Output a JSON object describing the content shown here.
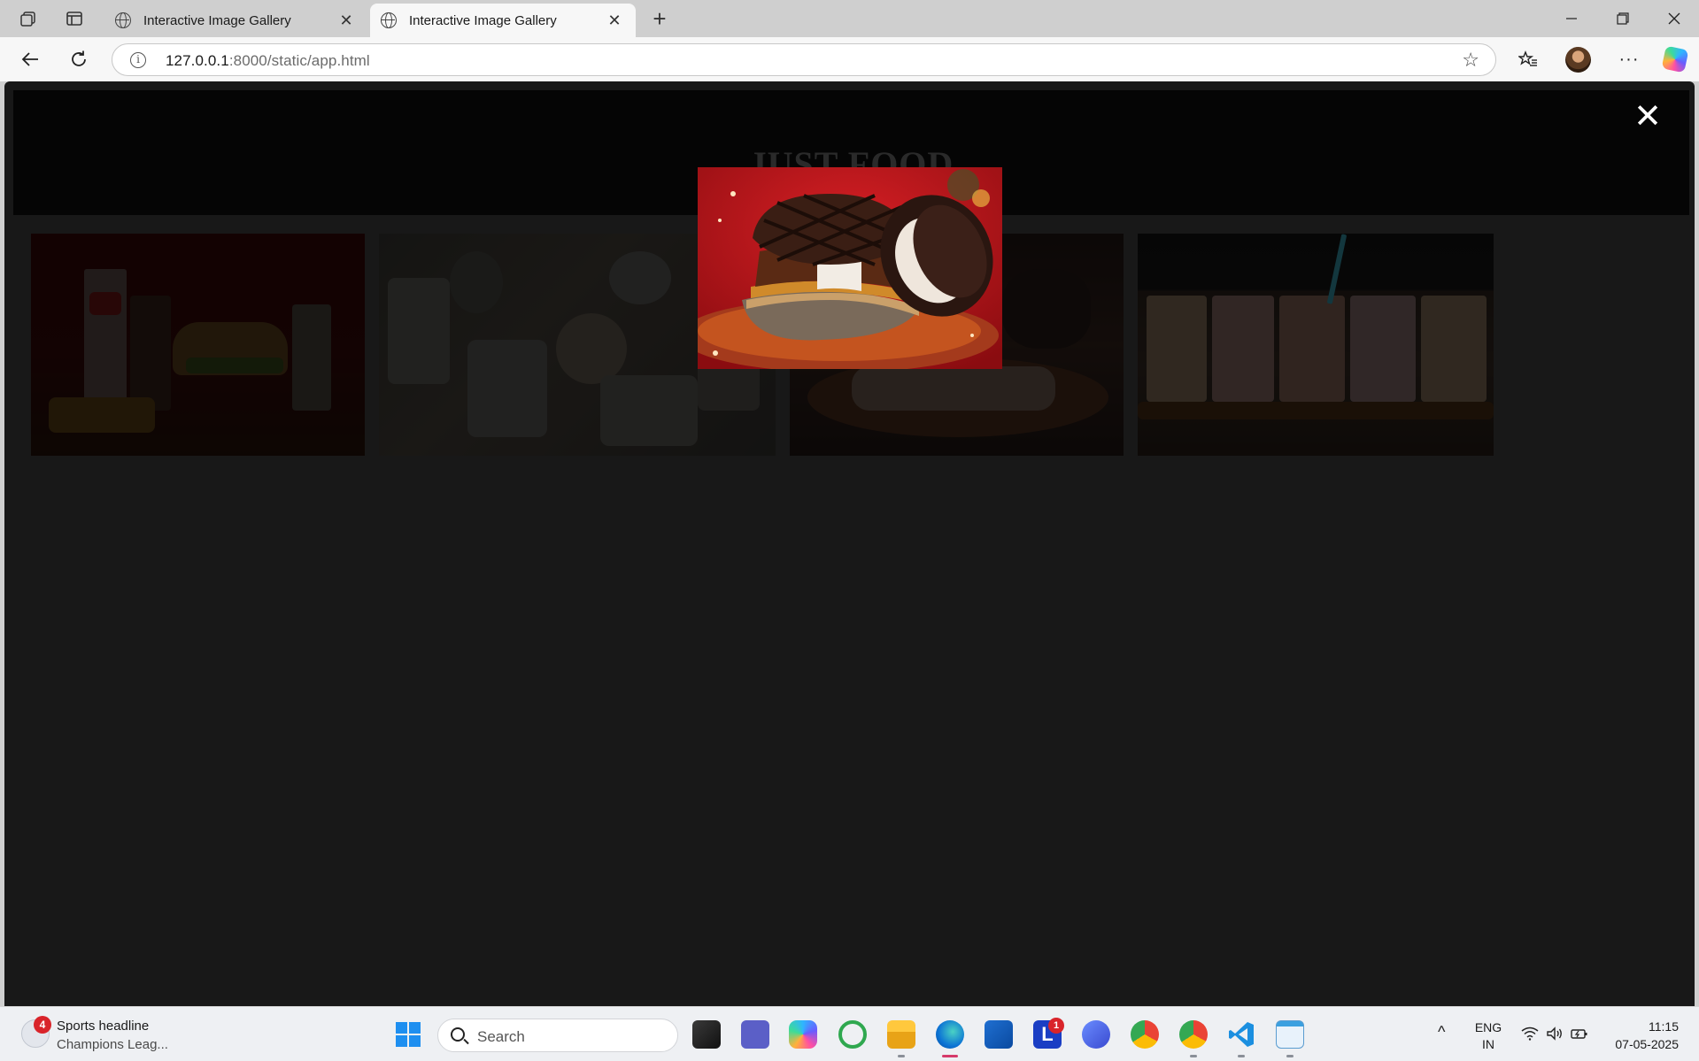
{
  "browser": {
    "tabs": [
      {
        "title": "Interactive Image Gallery",
        "active": false
      },
      {
        "title": "Interactive Image Gallery",
        "active": true
      }
    ],
    "url_host": "127.0.0.1",
    "url_rest": ":8000/static/app.html"
  },
  "page": {
    "site_title": "JUST FOOD",
    "modal_close_glyph": "✕",
    "gallery": [
      {
        "subject": "fast-food-meal"
      },
      {
        "subject": "coffee-cups"
      },
      {
        "subject": "waffle-sandwich"
      },
      {
        "subject": "bubble-tea"
      }
    ],
    "modal": {
      "open": true,
      "subject": "waffle-sandwich"
    }
  },
  "taskbar": {
    "news_title": "Sports headline",
    "news_subtitle": "Champions Leag...",
    "news_badge": "4",
    "search_placeholder": "Search",
    "apps": [
      "start",
      "task-view",
      "teams",
      "copilot",
      "app-ring",
      "file-explorer",
      "edge",
      "store",
      "l-app",
      "app-wave",
      "chrome",
      "chrome-profile",
      "vscode",
      "notepad"
    ],
    "l_badge": "1",
    "lang_top": "ENG",
    "lang_bottom": "IN",
    "time": "11:15",
    "date": "07-05-2025"
  },
  "colors": {
    "page_bg": "#181818",
    "header_bg": "#050505",
    "accent_red": "#c4141a"
  }
}
